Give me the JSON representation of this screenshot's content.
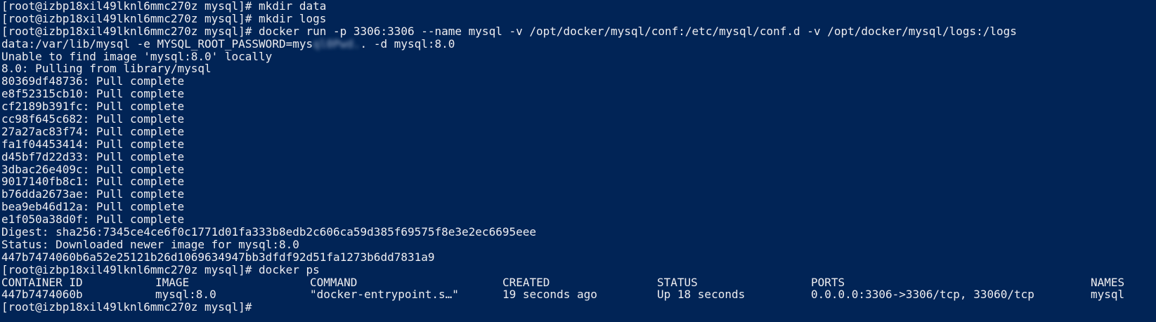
{
  "prompt": "[root@izbp18xil49lknl6mmc270z mysql]# ",
  "lines_top": [
    "[root@izbp18xil49lknl6mmc270z mysql]# mkdir data",
    "[root@izbp18xil49lknl6mmc270z mysql]# mkdir logs",
    "[root@izbp18xil49lknl6mmc270z mysql]# docker run -p 3306:3306 --name mysql -v /opt/docker/mysql/conf:/etc/mysql/conf.d -v /opt/docker/mysql/logs:/logs"
  ],
  "line_cont_prefix": "data:/var/lib/mysql -e MYSQL_ROOT_PASSWORD=mys",
  "line_cont_redacted": "ql0Pwd.",
  "line_cont_suffix": ". -d mysql:8.0",
  "lines_mid": [
    "Unable to find image 'mysql:8.0' locally",
    "8.0: Pulling from library/mysql",
    "80369df48736: Pull complete",
    "e8f52315cb10: Pull complete",
    "cf2189b391fc: Pull complete",
    "cc98f645c682: Pull complete",
    "27a27ac83f74: Pull complete",
    "fa1f04453414: Pull complete",
    "d45bf7d22d33: Pull complete",
    "3dbac26e409c: Pull complete",
    "9017140fb8c1: Pull complete",
    "b76dda2673ae: Pull complete",
    "bea9eb46d12a: Pull complete",
    "e1f050a38d0f: Pull complete",
    "Digest: sha256:7345ce4ce6f0c1771d01fa333b8edb2c606ca59d385f69575f8e3e2ec6695eee",
    "Status: Downloaded newer image for mysql:8.0",
    "447b7474060b6a52e25121b26d1069634947bb3dfdf92d51fa1273b6dd7831a9",
    "[root@izbp18xil49lknl6mmc270z mysql]# docker ps"
  ],
  "ps_table": {
    "headers": [
      "CONTAINER ID",
      "IMAGE",
      "COMMAND",
      "CREATED",
      "STATUS",
      "PORTS",
      "NAMES"
    ],
    "rows": [
      [
        "447b7474060b",
        "mysql:8.0",
        "\"docker-entrypoint.s…\"",
        "19 seconds ago",
        "Up 18 seconds",
        "0.0.0.0:3306->3306/tcp, 33060/tcp",
        "mysql"
      ]
    ]
  },
  "last_line": "[root@izbp18xil49lknl6mmc270z mysql]# "
}
